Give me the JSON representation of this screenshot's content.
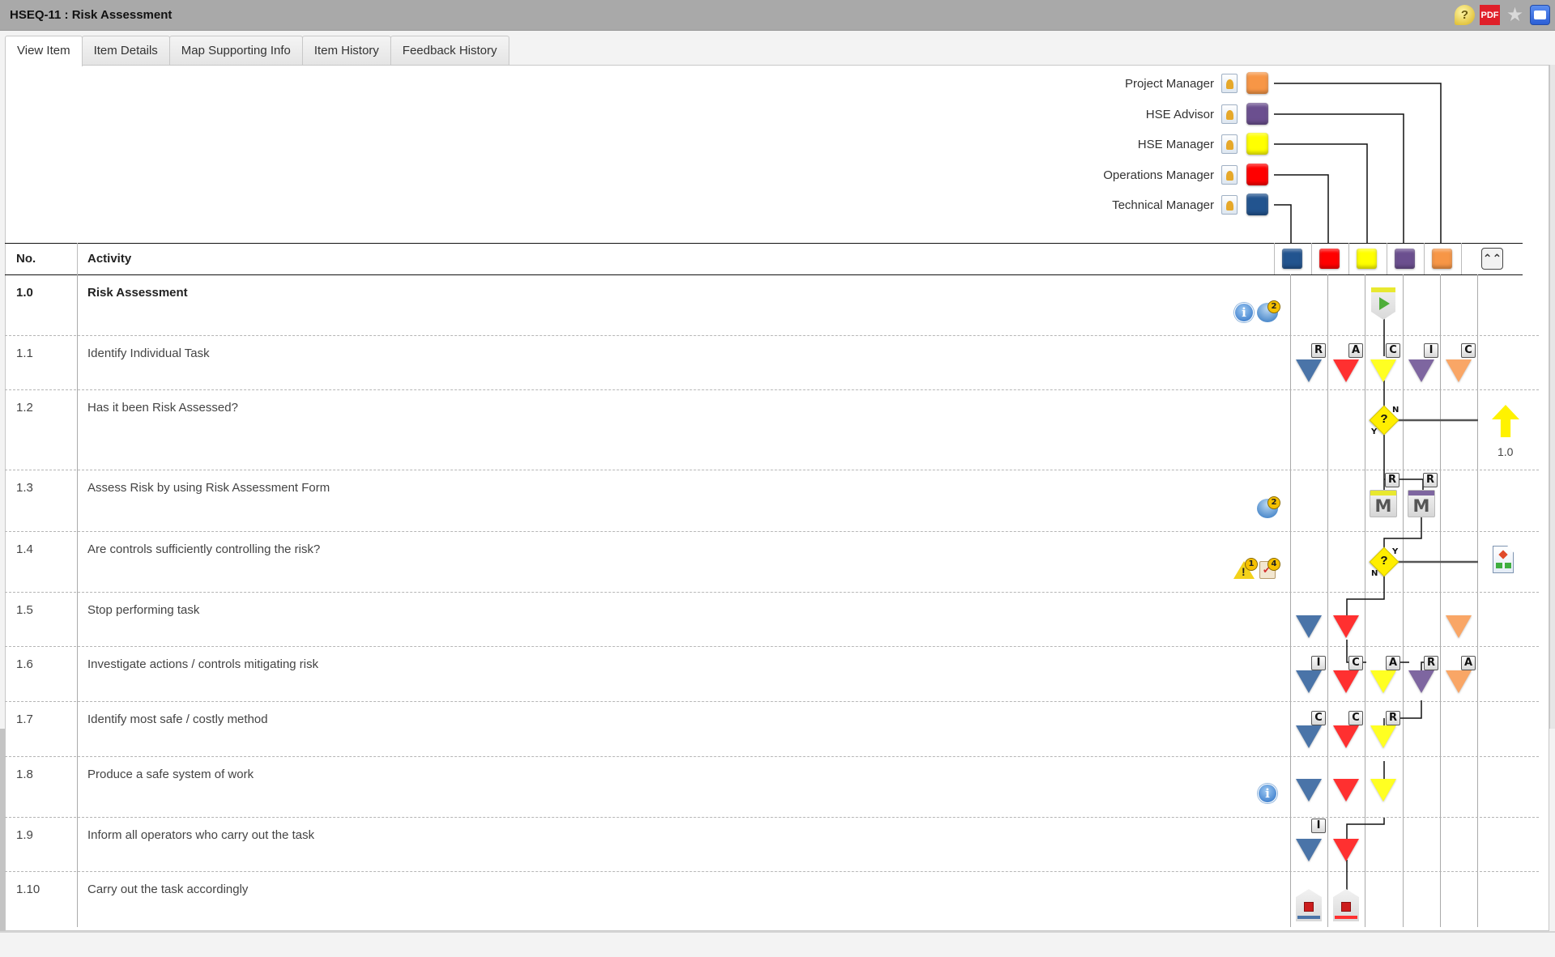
{
  "window": {
    "title": "HSEQ-11 : Risk Assessment",
    "toolbar_icons": [
      "help-icon",
      "pdf-icon",
      "favourite-star-icon",
      "feedback-chat-icon"
    ],
    "pdf_label": "PDF",
    "help_glyph": "?",
    "star_glyph": "★"
  },
  "tabs": [
    {
      "label": "View Item",
      "active": true
    },
    {
      "label": "Item Details",
      "active": false
    },
    {
      "label": "Map Supporting Info",
      "active": false
    },
    {
      "label": "Item History",
      "active": false
    },
    {
      "label": "Feedback History",
      "active": false
    }
  ],
  "roles": [
    {
      "name": "Project Manager",
      "color": "#f79646"
    },
    {
      "name": "HSE Advisor",
      "color": "#6b4f8f"
    },
    {
      "name": "HSE Manager",
      "color": "#ffff00"
    },
    {
      "name": "Operations Manager",
      "color": "#ff0000"
    },
    {
      "name": "Technical Manager",
      "color": "#22548f"
    }
  ],
  "table": {
    "headers": {
      "no": "No.",
      "activity": "Activity"
    },
    "collapse_glyph": "⌃⌃",
    "column_roles": [
      "Technical Manager",
      "Operations Manager",
      "HSE Manager",
      "HSE Advisor",
      "Project Manager"
    ],
    "triangle_colors": [
      "#4a74a8",
      "#ff3030",
      "#ffff22",
      "#7e66a0",
      "#f9a666"
    ],
    "rows": [
      {
        "no": "1.0",
        "activity": "Risk Assessment",
        "bold": true,
        "icons": [
          "info-icon",
          "linked-process-icon"
        ],
        "linked_count": "2",
        "start_role": "HSE Manager"
      },
      {
        "no": "1.1",
        "activity": "Identify Individual Task",
        "raci": [
          "R",
          "A",
          "C",
          "I",
          "C"
        ]
      },
      {
        "no": "1.2",
        "activity": "Has it been Risk Assessed?",
        "decision": {
          "owner": "HSE Manager",
          "yes": "Y",
          "no": "N",
          "goto": "1.0"
        }
      },
      {
        "no": "1.3",
        "activity": "Assess Risk by using Risk Assessment Form",
        "icons": [
          "linked-process-icon"
        ],
        "linked_count": "2",
        "meetings": [
          {
            "role": "HSE Manager",
            "raci": "R",
            "glyph": "M"
          },
          {
            "role": "HSE Advisor",
            "raci": "R",
            "glyph": "M"
          }
        ]
      },
      {
        "no": "1.4",
        "activity": "Are controls sufficiently controlling the risk?",
        "icons": [
          "risk-warning-icon",
          "control-checklist-icon"
        ],
        "risk_count": "1",
        "control_count": "4",
        "decision": {
          "owner": "HSE Manager",
          "yes": "Y",
          "no": "N",
          "goto": "process-map"
        }
      },
      {
        "no": "1.5",
        "activity": "Stop performing task",
        "raci": [
          "",
          "",
          "",
          "",
          ""
        ]
      },
      {
        "no": "1.6",
        "activity": "Investigate actions / controls mitigating risk",
        "raci": [
          "I",
          "C",
          "A",
          "R",
          "A"
        ]
      },
      {
        "no": "1.7",
        "activity": "Identify most safe / costly method",
        "raci": [
          "C",
          "C",
          "R",
          "",
          ""
        ]
      },
      {
        "no": "1.8",
        "activity": "Produce a safe system of work",
        "icons": [
          "info-icon"
        ],
        "raci": [
          "",
          "",
          "",
          "",
          ""
        ]
      },
      {
        "no": "1.9",
        "activity": "Inform all operators who carry out the task",
        "raci": [
          "I",
          "",
          "",
          "",
          ""
        ]
      },
      {
        "no": "1.10",
        "activity": "Carry out the task accordingly"
      }
    ]
  }
}
